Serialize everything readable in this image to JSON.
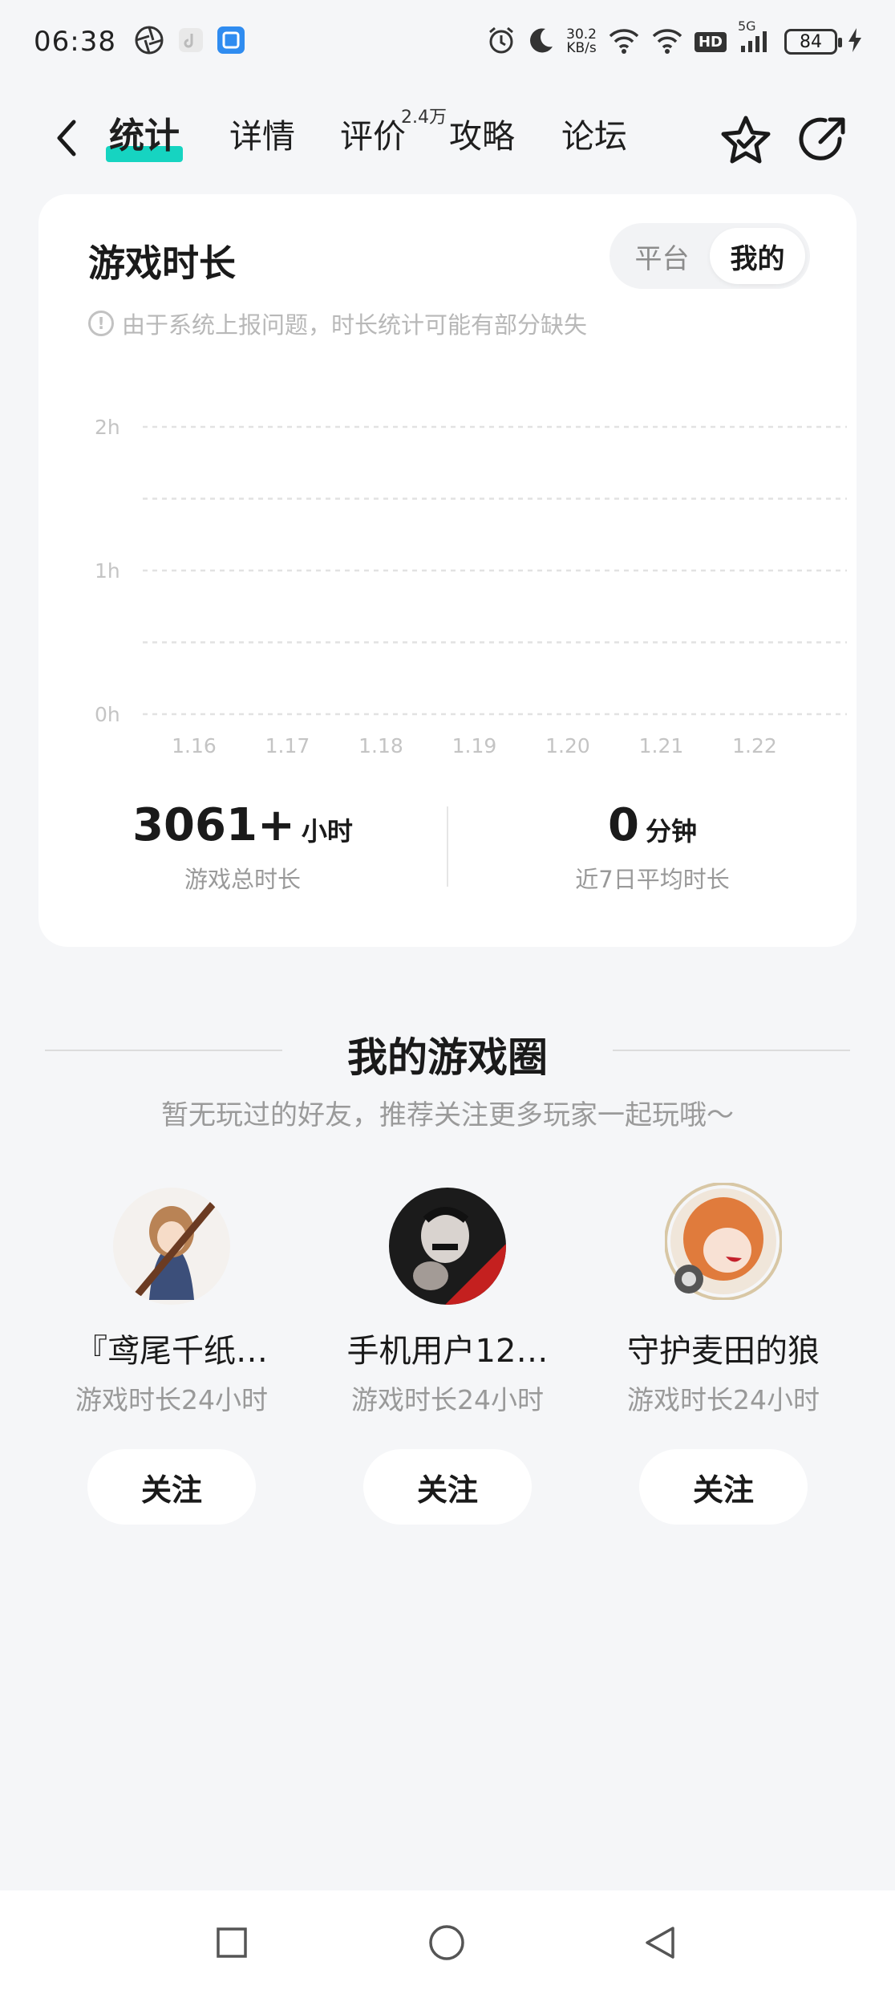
{
  "status_bar": {
    "time": "06:38",
    "net_speed_value": "30.2",
    "net_speed_unit": "KB/s",
    "hd": "HD",
    "network": "5G",
    "battery": "84"
  },
  "nav": {
    "tabs": [
      {
        "label": "统计",
        "active": true
      },
      {
        "label": "详情",
        "active": false
      },
      {
        "label": "评价",
        "active": false,
        "badge": "2.4万"
      },
      {
        "label": "攻略",
        "active": false
      },
      {
        "label": "论坛",
        "active": false
      }
    ]
  },
  "stats_card": {
    "title": "游戏时长",
    "segments": [
      "平台",
      "我的"
    ],
    "selected_segment": "我的",
    "notice": "由于系统上报问题，时长统计可能有部分缺失",
    "total": {
      "value": "3061+",
      "unit": "小时",
      "label": "游戏总时长"
    },
    "avg7": {
      "value": "0",
      "unit": "分钟",
      "label": "近7日平均时长"
    }
  },
  "chart_data": {
    "type": "bar",
    "categories": [
      "1.16",
      "1.17",
      "1.18",
      "1.19",
      "1.20",
      "1.21",
      "1.22"
    ],
    "values": [
      0,
      0,
      0,
      0,
      0,
      0,
      0
    ],
    "y_ticks": [
      "0h",
      "1h",
      "2h"
    ],
    "ylim": [
      0,
      2
    ],
    "grid": true
  },
  "game_circle": {
    "title": "我的游戏圈",
    "subtitle": "暂无玩过的好友，推荐关注更多玩家一起玩哦～",
    "friends": [
      {
        "name": "『鸢尾千纸…",
        "meta": "游戏时长24小时",
        "follow": "关注"
      },
      {
        "name": "手机用户12…",
        "meta": "游戏时长24小时",
        "follow": "关注"
      },
      {
        "name": "守护麦田的狼",
        "meta": "游戏时长24小时",
        "follow": "关注"
      }
    ]
  },
  "colors": {
    "accent": "#16d4c1",
    "background": "#f5f6f8",
    "card": "#ffffff"
  }
}
